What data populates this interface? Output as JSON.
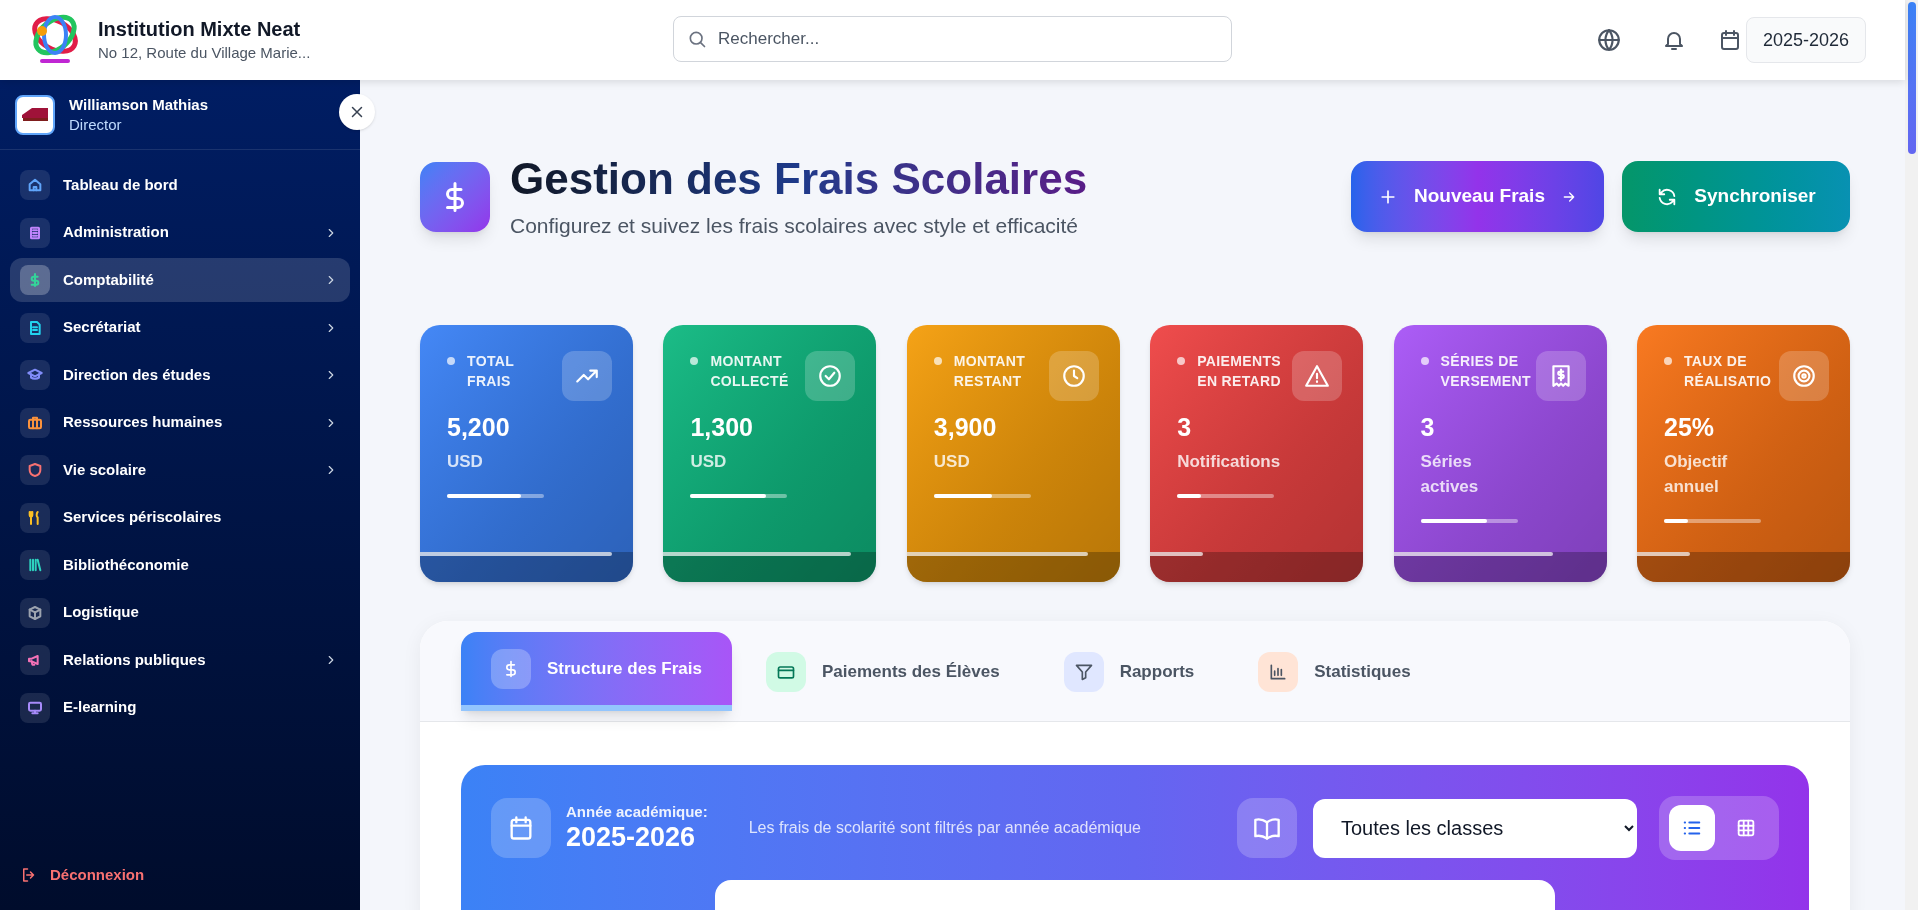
{
  "header": {
    "school_name": "Institution Mixte Neat",
    "address": "No 12, Route du Village Marie...",
    "search": {
      "placeholder": "Rechercher..."
    },
    "academic_year": "2025-2026"
  },
  "user": {
    "name": "Williamson Mathias",
    "role": "Director"
  },
  "sidebar": {
    "items": [
      {
        "label": "Tableau de bord",
        "selected": false,
        "has_submenu": false,
        "color": "#60a5fa"
      },
      {
        "label": "Administration",
        "selected": false,
        "has_submenu": true,
        "color": "#c084fc"
      },
      {
        "label": "Comptabilité",
        "selected": true,
        "has_submenu": true,
        "color": "#34d399"
      },
      {
        "label": "Secrétariat",
        "selected": false,
        "has_submenu": true,
        "color": "#22d3ee"
      },
      {
        "label": "Direction des études",
        "selected": false,
        "has_submenu": true,
        "color": "#818cf8"
      },
      {
        "label": "Ressources humaines",
        "selected": false,
        "has_submenu": true,
        "color": "#fb923c"
      },
      {
        "label": "Vie scolaire",
        "selected": false,
        "has_submenu": true,
        "color": "#f87171"
      },
      {
        "label": "Services périscolaires",
        "selected": false,
        "has_submenu": false,
        "color": "#fbbf24"
      },
      {
        "label": "Bibliothéconomie",
        "selected": false,
        "has_submenu": false,
        "color": "#2dd4bf"
      },
      {
        "label": "Logistique",
        "selected": false,
        "has_submenu": false,
        "color": "#9ca3af"
      },
      {
        "label": "Relations publiques",
        "selected": false,
        "has_submenu": true,
        "color": "#f472b6"
      },
      {
        "label": "E-learning",
        "selected": false,
        "has_submenu": false,
        "color": "#a78bfa"
      }
    ],
    "logout": "Déconnexion"
  },
  "page": {
    "title": "Gestion des Frais Scolaires",
    "subtitle": "Configurez et suivez les frais scolaires avec style et efficacité",
    "buttons": [
      "Nouveau Frais",
      "Synchroniser"
    ]
  },
  "stats": [
    {
      "label": "TOTAL FRAIS",
      "value": "5,200",
      "unit": "USD",
      "color": "#3b82f6",
      "level": 0.76,
      "bottom_bar": {
        "level": 0.9
      }
    },
    {
      "label": "MONTANT COLLECTÉ",
      "value": "1,300",
      "unit": "USD",
      "color": "#10b981",
      "level": 0.78,
      "bottom_bar": {
        "level": 0.88
      }
    },
    {
      "label": "MONTANT RESTANT",
      "value": "3,900",
      "unit": "USD",
      "color": "#f59e0b",
      "level": 0.6,
      "bottom_bar": {
        "level": 0.85
      }
    },
    {
      "label": "PAIEMENTS EN RETARD",
      "value": "3",
      "unit": "Notifications",
      "color": "#ef4444",
      "level": 0.25,
      "bottom_bar": {
        "level": 0.25
      }
    },
    {
      "label": "SÉRIES DE VERSEMENT",
      "value": "3",
      "unit": "Séries actives",
      "color": "#a855f7",
      "level": 0.68,
      "bottom_bar": {
        "level": 0.75
      }
    },
    {
      "label": "TAUX DE RÉALISATIO",
      "value": "25%",
      "unit": "Objectif annuel",
      "color": "#f97316",
      "level": 0.25,
      "bottom_bar": {
        "level": 0.25
      }
    }
  ],
  "tabs": [
    {
      "label": "Structure des Frais",
      "selected": true
    },
    {
      "label": "Paiements des Élèves",
      "selected": false
    },
    {
      "label": "Rapports",
      "selected": false
    },
    {
      "label": "Statistiques",
      "selected": false
    }
  ],
  "filter_bar": {
    "year_label": "Année académique:",
    "year": "2025-2026",
    "description": "Les frais de scolarité sont filtrés par année académique",
    "class_select": "Toutes les classes",
    "views": [
      {
        "kind": "list",
        "selected": true
      },
      {
        "kind": "grid",
        "selected": false
      }
    ]
  }
}
